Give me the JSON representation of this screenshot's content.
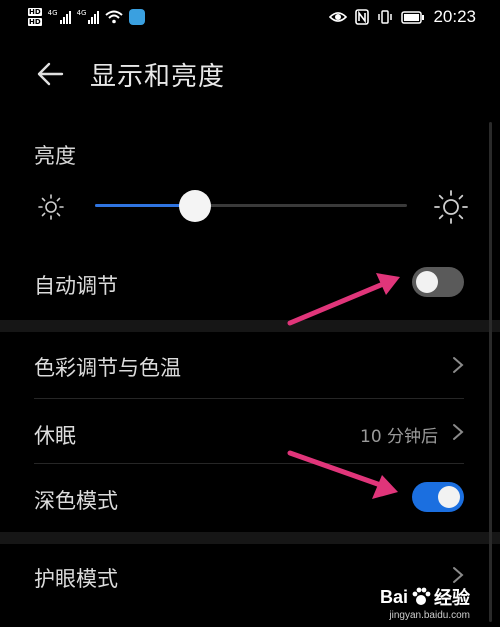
{
  "status_bar": {
    "time": "20:23",
    "hd_label": "HD",
    "net_label": "4G"
  },
  "header": {
    "title": "显示和亮度"
  },
  "brightness": {
    "label": "亮度",
    "level_percent": 32
  },
  "rows": {
    "auto_adjust": {
      "label": "自动调节",
      "toggle_on": false
    },
    "color_temp": {
      "label": "色彩调节与色温"
    },
    "sleep": {
      "label": "休眠",
      "value": "10 分钟后"
    },
    "dark_mode": {
      "label": "深色模式",
      "toggle_on": true
    },
    "eye_comfort": {
      "label": "护眼模式"
    }
  },
  "annotations": {
    "arrow_color": "#e0357a"
  },
  "watermark": {
    "brand_left": "Bai",
    "brand_right": "经验",
    "url": "jingyan.baidu.com"
  },
  "colors": {
    "accent": "#1b6fe0",
    "background": "#000000"
  }
}
